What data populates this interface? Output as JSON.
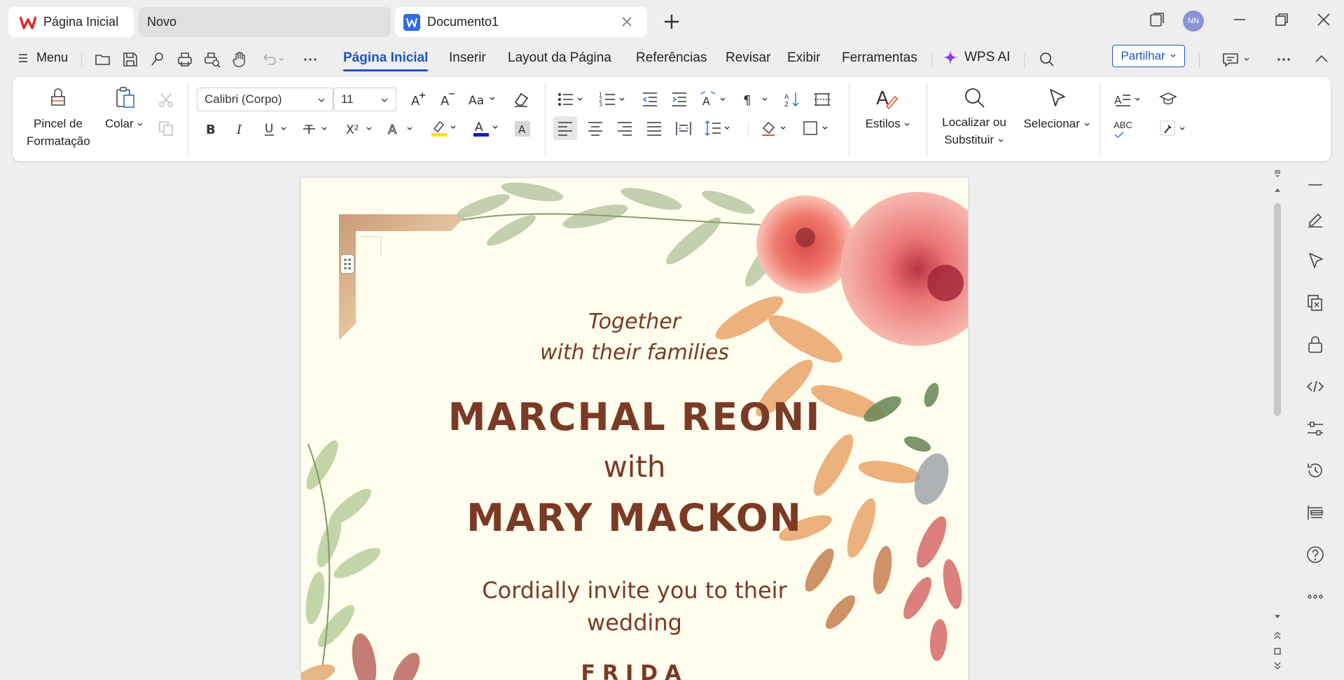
{
  "tabs": [
    {
      "label": "Página Inicial"
    },
    {
      "label": "Novo"
    },
    {
      "label": "Documento1"
    }
  ],
  "account": {
    "initials": "NN"
  },
  "menu": {
    "menu_label": "Menu",
    "tabs": [
      "Página Inicial",
      "Inserir",
      "Layout da Página",
      "Referências",
      "Revisar",
      "Exibir",
      "Ferramentas"
    ],
    "active_tab": "Página Inicial",
    "ai_label": "WPS AI",
    "share_label": "Partilhar"
  },
  "ribbon": {
    "format_painter_line1": "Pincel de",
    "format_painter_line2": "Formatação",
    "paste_label": "Colar",
    "font_name": "Calibri (Corpo)",
    "font_size": "11",
    "styles_label": "Estilos",
    "find_line1": "Localizar ou",
    "find_line2": "Substituir",
    "select_label": "Selecionar",
    "spell_label": "ABC",
    "colors": {
      "highlight": "#ffe600",
      "font_color": "#1020c8",
      "accent": "#1a56c4"
    }
  },
  "document": {
    "line1": "Together",
    "line2": "with their families",
    "name1": "MARCHAL REONI",
    "with": "with",
    "name2": "MARY MACKON",
    "invite1": "Cordially invite you to their",
    "invite2": "wedding",
    "day_partial": "FRIDA"
  }
}
